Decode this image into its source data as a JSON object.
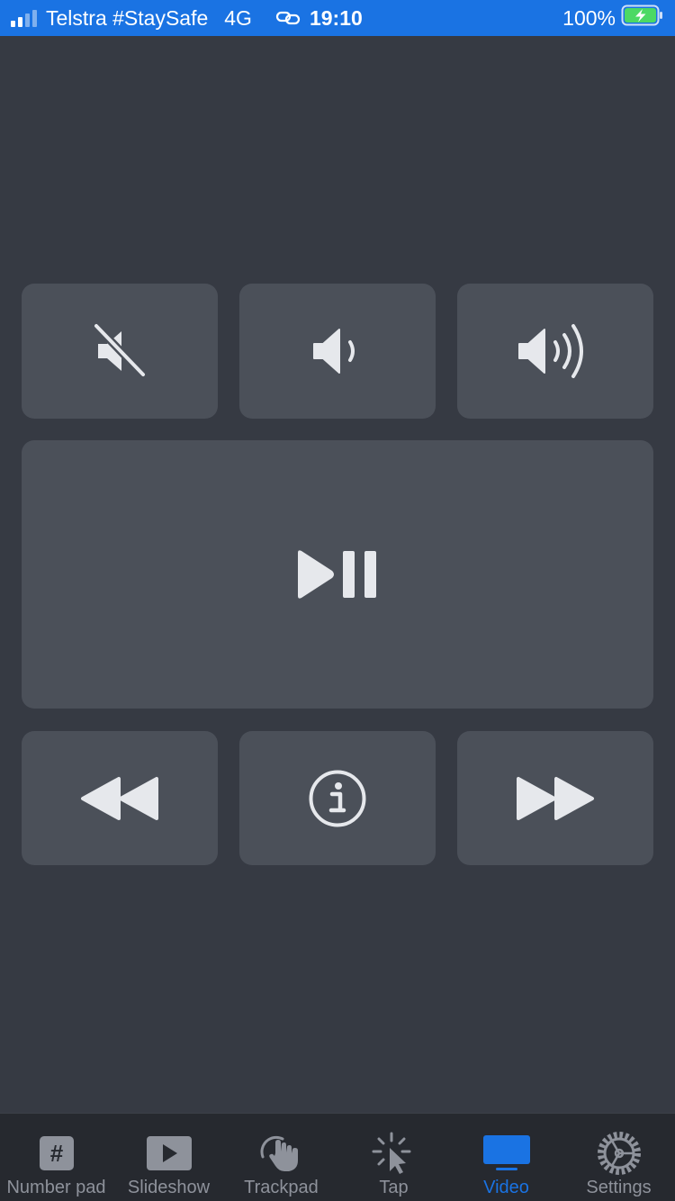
{
  "status_bar": {
    "carrier": "Telstra #StaySafe",
    "network": "4G",
    "time": "19:10",
    "battery": "100%",
    "icons": [
      "signal-icon",
      "link-icon",
      "battery-charging-icon"
    ]
  },
  "controls": {
    "row1": [
      {
        "icon": "mute-icon"
      },
      {
        "icon": "volume-down-icon"
      },
      {
        "icon": "volume-up-icon"
      }
    ],
    "main": {
      "icon": "play-pause-icon"
    },
    "row3": [
      {
        "icon": "rewind-icon"
      },
      {
        "icon": "info-icon"
      },
      {
        "icon": "fast-forward-icon"
      }
    ]
  },
  "tabs": [
    {
      "label": "Number pad",
      "icon": "number-pad-icon",
      "active": false
    },
    {
      "label": "Slideshow",
      "icon": "slideshow-icon",
      "active": false
    },
    {
      "label": "Trackpad",
      "icon": "trackpad-icon",
      "active": false
    },
    {
      "label": "Tap",
      "icon": "tap-icon",
      "active": false
    },
    {
      "label": "Video",
      "icon": "video-icon",
      "active": true
    },
    {
      "label": "Settings",
      "icon": "settings-icon",
      "active": false
    }
  ],
  "colors": {
    "background": "#363a43",
    "button": "#4b5059",
    "icon": "#e6e8ec",
    "accent": "#1a73e3",
    "tab_bar": "#26292f",
    "tab_inactive": "#8e929b"
  }
}
